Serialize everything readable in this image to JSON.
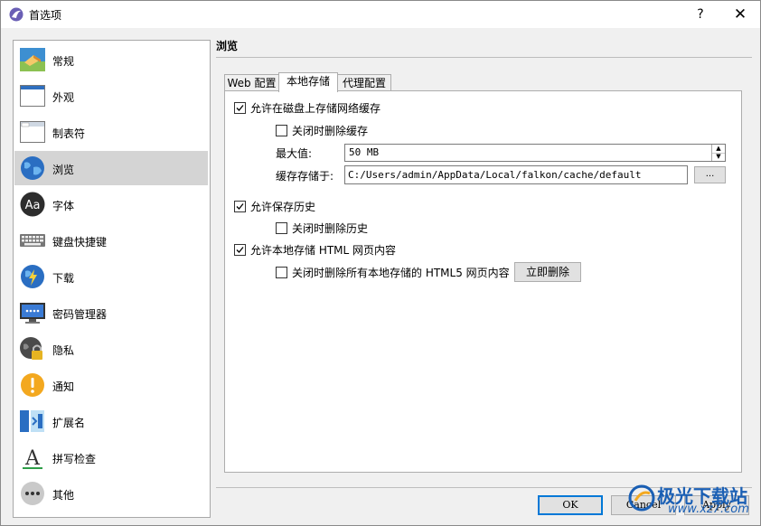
{
  "window": {
    "title": "首选项",
    "help": "?",
    "close": "✕"
  },
  "sidebar": {
    "items": [
      {
        "label": "常规",
        "icon": "general-icon"
      },
      {
        "label": "外观",
        "icon": "appearance-icon"
      },
      {
        "label": "制表符",
        "icon": "tabs-icon"
      },
      {
        "label": "浏览",
        "icon": "browsing-icon",
        "selected": true
      },
      {
        "label": "字体",
        "icon": "fonts-icon"
      },
      {
        "label": "键盘快捷键",
        "icon": "keyboard-icon"
      },
      {
        "label": "下载",
        "icon": "download-icon"
      },
      {
        "label": "密码管理器",
        "icon": "password-manager-icon"
      },
      {
        "label": "隐私",
        "icon": "privacy-icon"
      },
      {
        "label": "通知",
        "icon": "notifications-icon"
      },
      {
        "label": "扩展名",
        "icon": "extensions-icon"
      },
      {
        "label": "拼写检查",
        "icon": "spellcheck-icon"
      },
      {
        "label": "其他",
        "icon": "other-icon"
      }
    ]
  },
  "content": {
    "section_title": "浏览",
    "tabs": [
      {
        "label": "Web 配置"
      },
      {
        "label": "本地存储",
        "active": true
      },
      {
        "label": "代理配置"
      }
    ],
    "allow_disk_cache": {
      "label": "允许在磁盘上存储网络缓存",
      "checked": true
    },
    "delete_cache_on_close": {
      "label": "关闭时删除缓存",
      "checked": false
    },
    "max_size": {
      "label": "最大值:",
      "value": "50 MB"
    },
    "cache_path": {
      "label": "缓存存储于:",
      "value": "C:/Users/admin/AppData/Local/falkon/cache/default",
      "browse": "..."
    },
    "allow_history": {
      "label": "允许保存历史",
      "checked": true
    },
    "delete_history_on_close": {
      "label": "关闭时删除历史",
      "checked": false
    },
    "allow_html5_storage": {
      "label": "允许本地存储 HTML 网页内容",
      "checked": true
    },
    "delete_html5_on_close": {
      "label": "关闭时删除所有本地存储的 HTML5 网页内容",
      "checked": false
    },
    "delete_now": "立即删除"
  },
  "buttons": {
    "ok": "OK",
    "cancel": "Cancel",
    "apply": "Apply"
  },
  "watermark": {
    "text": "极光下载站",
    "url": "www.xz7.com"
  },
  "colors": {
    "accent": "#0078d7",
    "selected_bg": "#d4d4d4"
  }
}
